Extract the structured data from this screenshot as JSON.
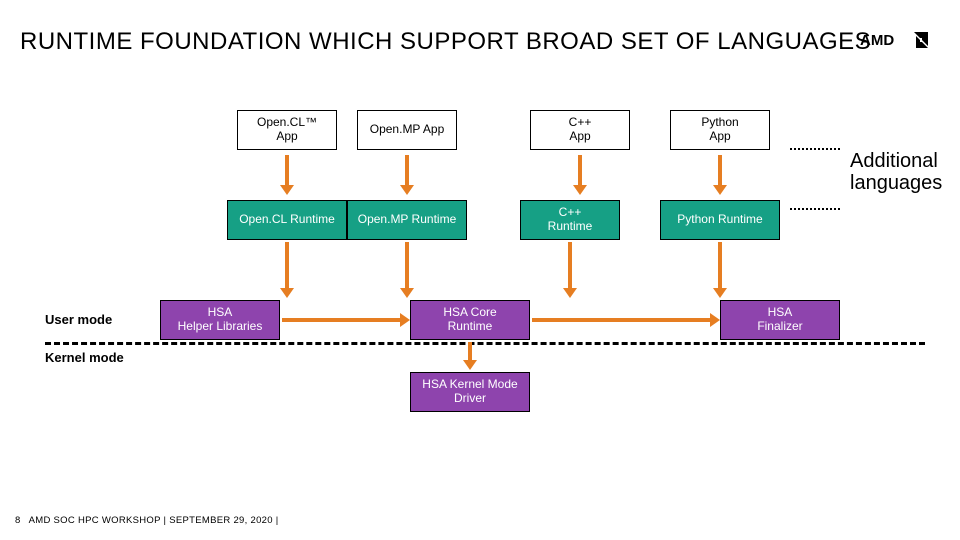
{
  "title": "RUNTIME FOUNDATION WHICH SUPPORT BROAD SET OF LANGUAGES",
  "logo_text": "AMD",
  "apps": {
    "opencl": "Open.CL™\nApp",
    "openmp": "Open.MP App",
    "cpp": "C++\nApp",
    "python": "Python\nApp"
  },
  "runtimes": {
    "opencl": "Open.CL Runtime",
    "openmp": "Open.MP Runtime",
    "cpp": "C++\nRuntime",
    "python": "Python Runtime"
  },
  "hsa": {
    "helper": "HSA\nHelper Libraries",
    "core": "HSA Core\nRuntime",
    "finalizer": "HSA\nFinalizer",
    "kernel": "HSA Kernel Mode\nDriver"
  },
  "labels": {
    "user_mode": "User mode",
    "kernel_mode": "Kernel mode",
    "additional": "Additional\nlanguages"
  },
  "footer": {
    "page": "8",
    "line": "AMD SOC HPC WORKSHOP |  SEPTEMBER 29, 2020  |"
  },
  "colors": {
    "teal": "#16a085",
    "purple": "#8e44ad",
    "orange": "#e67e22"
  }
}
